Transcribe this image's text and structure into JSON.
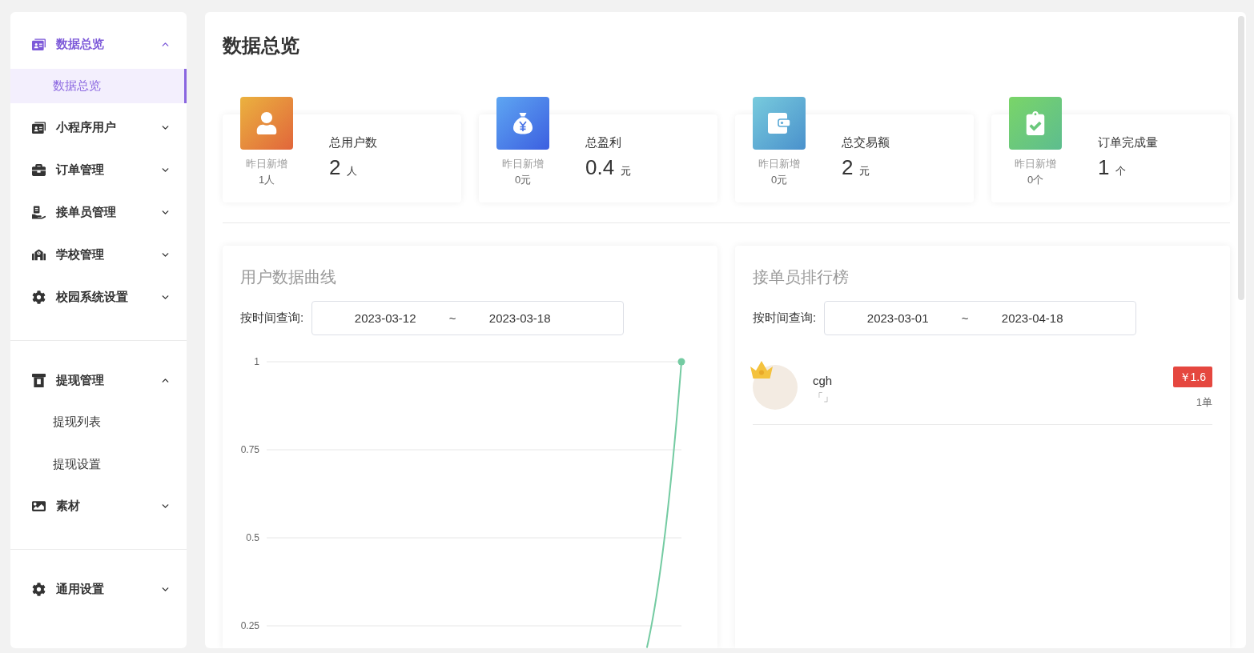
{
  "sidebar": {
    "sections": [
      {
        "groups": [
          {
            "label": "数据总览",
            "expanded": true,
            "children": [
              {
                "label": "数据总览",
                "selected": true
              }
            ]
          },
          {
            "label": "小程序用户",
            "expanded": false
          },
          {
            "label": "订单管理",
            "expanded": false
          },
          {
            "label": "接单员管理",
            "expanded": false
          },
          {
            "label": "学校管理",
            "expanded": false
          },
          {
            "label": "校园系统设置",
            "expanded": false
          }
        ]
      },
      {
        "groups": [
          {
            "label": "提现管理",
            "expanded": true,
            "children": [
              {
                "label": "提现列表",
                "selected": false
              },
              {
                "label": "提现设置",
                "selected": false
              }
            ]
          },
          {
            "label": "素材",
            "expanded": false
          }
        ]
      },
      {
        "groups": [
          {
            "label": "通用设置",
            "expanded": false
          }
        ]
      }
    ]
  },
  "page": {
    "title": "数据总览"
  },
  "stats": [
    {
      "title": "总用户数",
      "value": "2",
      "unit": "人",
      "yesterday_label": "昨日新增",
      "yesterday_value": "1人"
    },
    {
      "title": "总盈利",
      "value": "0.4",
      "unit": "元",
      "yesterday_label": "昨日新增",
      "yesterday_value": "0元"
    },
    {
      "title": "总交易额",
      "value": "2",
      "unit": "元",
      "yesterday_label": "昨日新增",
      "yesterday_value": "0元"
    },
    {
      "title": "订单完成量",
      "value": "1",
      "unit": "个",
      "yesterday_label": "昨日新增",
      "yesterday_value": "0个"
    }
  ],
  "user_chart": {
    "title": "用户数据曲线",
    "query_label": "按时间查询:",
    "date_from": "2023-03-12",
    "separator": "~",
    "date_to": "2023-03-18",
    "y_axis_labels": [
      "1",
      "0.75",
      "0.5",
      "0.25"
    ]
  },
  "ranking": {
    "title": "接单员排行榜",
    "query_label": "按时间查询:",
    "date_from": "2023-03-01",
    "separator": "~",
    "date_to": "2023-04-18",
    "items": [
      {
        "name": "cgh",
        "note": "「」",
        "crown": true,
        "amount": "￥1.6",
        "orders": "1单"
      }
    ]
  }
}
